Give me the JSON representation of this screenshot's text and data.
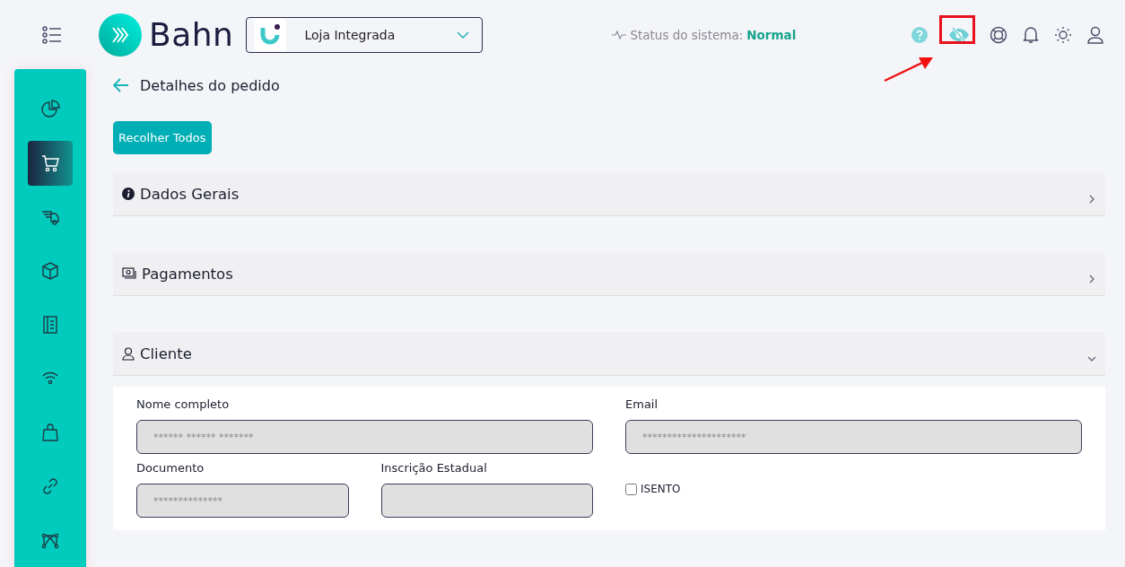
{
  "header": {
    "brand": "Bahn",
    "store": {
      "name": "Loja Integrada"
    },
    "status": {
      "label": "Status do sistema:",
      "value": "Normal"
    },
    "actions": [
      {
        "kind": "help"
      },
      {
        "kind": "hide",
        "highlighted": true
      },
      {
        "kind": "support"
      },
      {
        "kind": "bell"
      },
      {
        "kind": "theme"
      },
      {
        "kind": "user"
      }
    ]
  },
  "sidebar": {
    "items": [
      {
        "kind": "chart",
        "selected": false
      },
      {
        "kind": "cart",
        "selected": true
      },
      {
        "kind": "truck",
        "selected": false
      },
      {
        "kind": "box",
        "selected": false
      },
      {
        "kind": "book",
        "selected": false
      },
      {
        "kind": "wifi",
        "selected": false
      },
      {
        "kind": "bag",
        "selected": false
      },
      {
        "kind": "link",
        "selected": false
      },
      {
        "kind": "nodes",
        "selected": false
      }
    ]
  },
  "page": {
    "title": "Detalhes do pedido",
    "collapse_button": "Recolher Todos"
  },
  "sections": [
    {
      "kind": "info",
      "title": "Dados Gerais",
      "expanded": false
    },
    {
      "kind": "payments",
      "title": "Pagamentos",
      "expanded": false
    },
    {
      "kind": "client",
      "title": "Cliente",
      "expanded": true
    }
  ],
  "client_form": {
    "fields": [
      {
        "label": "Nome completo",
        "value": "****** ****** *******",
        "disabled": true
      },
      {
        "label": "Email",
        "value": "*********************",
        "disabled": true
      },
      {
        "label": "Documento",
        "value": "**************",
        "disabled": true
      },
      {
        "label": "Inscrição Estadual",
        "disabled": true
      }
    ],
    "exempt": {
      "label": "ISENTO",
      "checked": false
    }
  }
}
